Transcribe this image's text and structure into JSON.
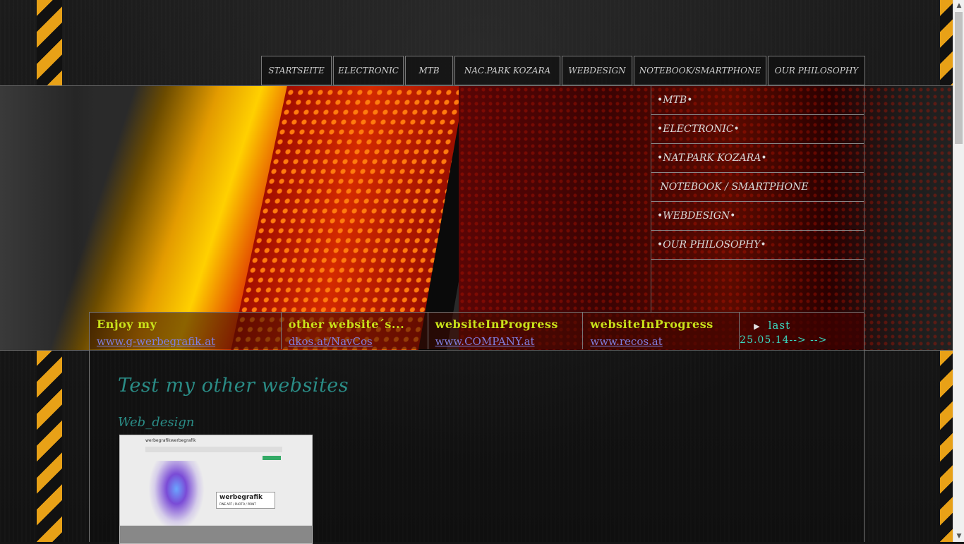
{
  "topnav": {
    "tabs": [
      {
        "label": "STARTSEITE"
      },
      {
        "label": "ELECTRONIC"
      },
      {
        "label": "MTB"
      },
      {
        "label": "NAC.PARK KOZARA"
      },
      {
        "label": "WEBDESIGN"
      },
      {
        "label": "NOTEBOOK/SMARTPHONE"
      },
      {
        "label": "OUR PHILOSOPHY"
      }
    ]
  },
  "sidemenu": {
    "items": [
      {
        "label": "•MTB•"
      },
      {
        "label": "•ELECTRONIC•"
      },
      {
        "label": "•NAT.PARK KOZARA•"
      },
      {
        "label": " NOTEBOOK / SMARTPHONE"
      },
      {
        "label": "•WEBDESIGN•"
      },
      {
        "label": "•OUR PHILOSOPHY•"
      }
    ]
  },
  "feature": {
    "cols": [
      {
        "title": "Enjoy my",
        "link": "www.g-werbegrafik.at"
      },
      {
        "title": "other website´s...",
        "link": "dkos.at/NavCos"
      },
      {
        "title": "websiteInProgress",
        "link": "www.COMPANY.at"
      },
      {
        "title": "websiteInProgress",
        "link": "www.recos.at"
      }
    ],
    "last": {
      "arrow": "▶",
      "title": "last",
      "date": "25.05.14--> -->"
    }
  },
  "main": {
    "heading": "Test my other websites",
    "subheading": "Web_design",
    "thumb": {
      "site_title": "werbegrafikwerbegrafik",
      "logo_text": "werbegrafik",
      "logo_sub": "FINE ART / PHOTO / PRINT"
    }
  },
  "scrollbar": {
    "up": "▲",
    "down": "▼"
  }
}
